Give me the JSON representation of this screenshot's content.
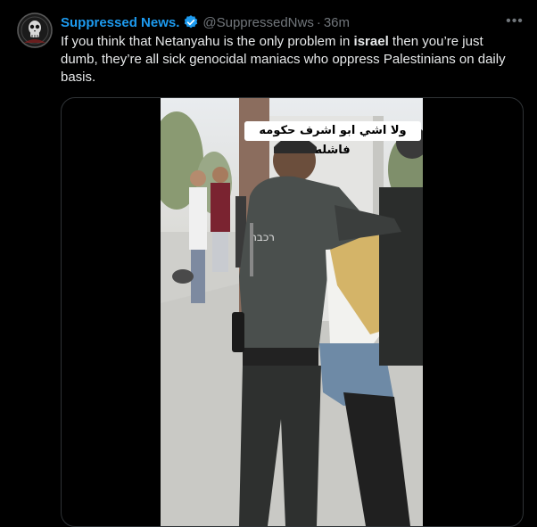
{
  "author": {
    "display_name": "Suppressed News.",
    "handle": "@SuppressedNws",
    "separator": "·",
    "time": "36m",
    "avatar_icon": "skull-portrait-avatar",
    "verified_icon": "verified-badge-icon",
    "verified_color": "#1d9bf0"
  },
  "menu": {
    "more_label": "•••"
  },
  "tweet": {
    "text_before": "If you think that Netanyahu is the only problem in ",
    "text_bold": "israel",
    "text_after": " then you’re just dumb, they’re all sick genocidal maniacs who oppress Palestinians on daily basis."
  },
  "video": {
    "caption": "ولا اشي ابو اشرف حكومه فاشله",
    "uniform_text": "רכבת"
  },
  "colors": {
    "background": "#000000",
    "text": "#e7e9ea",
    "secondary": "#71767b",
    "accent": "#1d9bf0",
    "border": "#2f3336"
  }
}
